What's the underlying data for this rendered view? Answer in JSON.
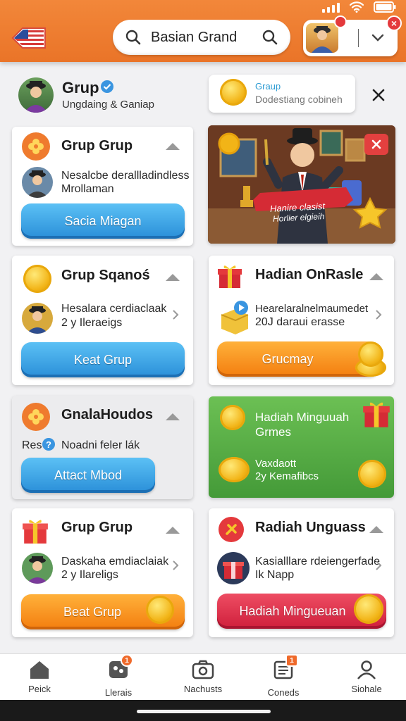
{
  "header": {
    "search_text": "Basian Grand",
    "profile_badge": "",
    "close_badge": "×"
  },
  "group_header": {
    "name": "Grup",
    "subtitle": "Ungdaing & Ganiap",
    "notice_title": "Graup",
    "notice_text": "Dodestiang cobineh"
  },
  "cards": [
    {
      "title": "Grup Grup",
      "sub1": "Nesalcbe derallladindless",
      "sub2": "Mrollaman",
      "button": "Sacia Miagan"
    },
    {
      "banner_text1": "Hanire clasist",
      "banner_text2": "Horlier elgieih"
    },
    {
      "title": "Grup Sqanoś",
      "sub1": "Hesalara cerdiaclaak",
      "sub2": "2 y Ileraeigs",
      "button": "Keat Grup"
    },
    {
      "title": "Hadian OnRasle",
      "sub1": "Hearelaralnelmaumedet",
      "sub2": "20J daraui erasse",
      "button": "Grucmay"
    },
    {
      "title": "GnalaHoudos",
      "sub_prefix": "Res",
      "sub1": "Noadni feler lák",
      "button": "Attact Mbod"
    },
    {
      "title": "Hadiah Minguuah",
      "sub_title2": "Grmes",
      "sub1": "Vaxdaott",
      "sub2": "2y Kemafibcs"
    },
    {
      "title": "Grup Grup",
      "sub1": "Daskaha emdiaclaiak",
      "sub2": "2 y Ilareligs",
      "button": "Beat Grup"
    },
    {
      "title": "Radiah Unguass",
      "sub1": "Kasialllare rdeiengerfade",
      "sub2": "Ik Napp",
      "button": "Hadiah Mingueuan"
    }
  ],
  "nav": [
    {
      "label": "Peick",
      "badge": ""
    },
    {
      "label": "Llerais",
      "badge": "1"
    },
    {
      "label": "Nachusts",
      "badge": ""
    },
    {
      "label": "Coneds",
      "badge": "1"
    },
    {
      "label": "Siohale",
      "badge": ""
    }
  ],
  "colors": {
    "accent": "#ef7b2e",
    "blue": "#2a8ed8",
    "green": "#58b448",
    "red": "#d92c44"
  }
}
